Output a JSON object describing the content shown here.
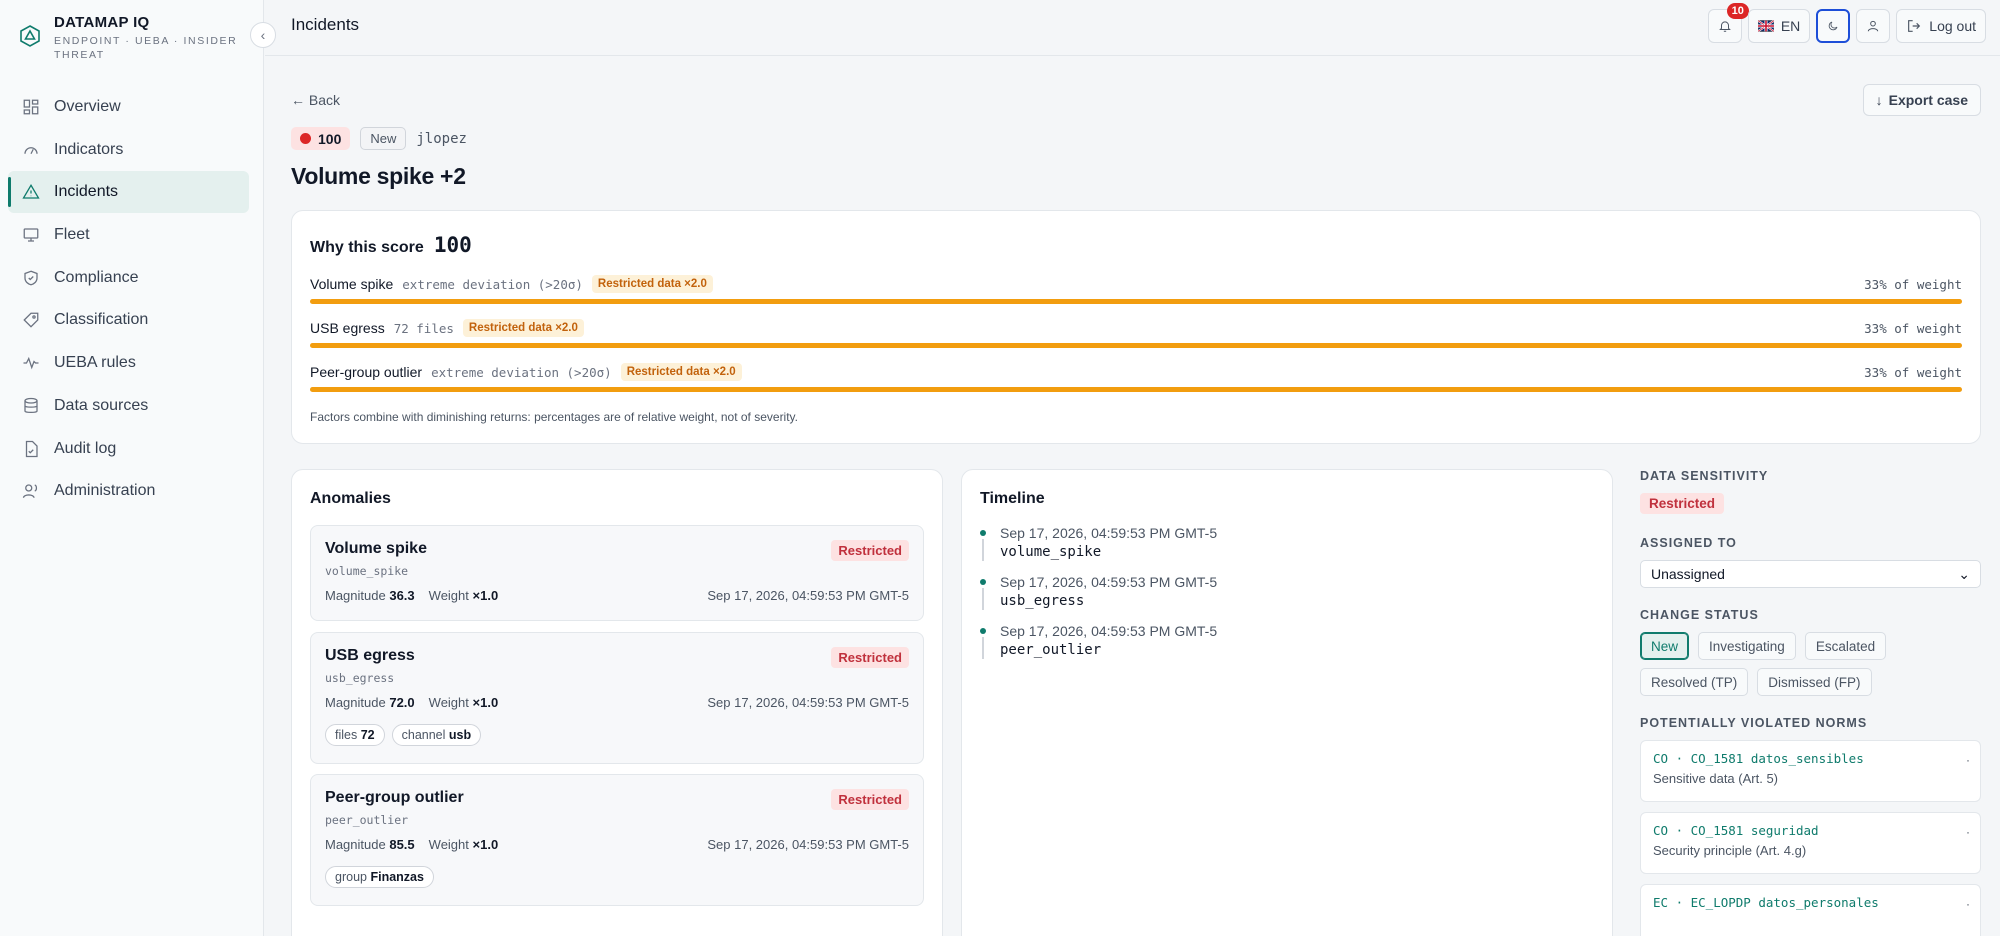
{
  "brand": {
    "name": "DATAMAP IQ",
    "subtitle": "ENDPOINT · UEBA · INSIDER THREAT"
  },
  "sidebar": {
    "items": [
      {
        "label": "Overview",
        "icon": "grid-icon"
      },
      {
        "label": "Indicators",
        "icon": "gauge-icon"
      },
      {
        "label": "Incidents",
        "icon": "alert-triangle-icon",
        "active": true
      },
      {
        "label": "Fleet",
        "icon": "monitor-icon"
      },
      {
        "label": "Compliance",
        "icon": "shield-check-icon"
      },
      {
        "label": "Classification",
        "icon": "tag-icon"
      },
      {
        "label": "UEBA rules",
        "icon": "activity-icon"
      },
      {
        "label": "Data sources",
        "icon": "database-icon"
      },
      {
        "label": "Audit log",
        "icon": "file-check-icon"
      },
      {
        "label": "Administration",
        "icon": "users-icon"
      }
    ]
  },
  "header": {
    "title": "Incidents",
    "notification_count": "10",
    "language": "EN",
    "logout_label": "Log out"
  },
  "incident": {
    "back_label": "Back",
    "export_label": "Export case",
    "score": "100",
    "status": "New",
    "user": "jlopez",
    "title": "Volume spike +2"
  },
  "score_card": {
    "title": "Why this score",
    "score": "100",
    "factors": [
      {
        "name": "Volume spike",
        "detail": "extreme deviation (>20σ)",
        "tag": "Restricted data ×2.0",
        "weight_label": "33% of weight",
        "fill": 1.0
      },
      {
        "name": "USB egress",
        "detail": "72 files",
        "tag": "Restricted data ×2.0",
        "weight_label": "33% of weight",
        "fill": 1.0
      },
      {
        "name": "Peer-group outlier",
        "detail": "extreme deviation (>20σ)",
        "tag": "Restricted data ×2.0",
        "weight_label": "33% of weight",
        "fill": 1.0
      }
    ],
    "note": "Factors combine with diminishing returns: percentages are of relative weight, not of severity."
  },
  "anomalies": {
    "title": "Anomalies",
    "magnitude_label": "Magnitude",
    "weight_label": "Weight",
    "items": [
      {
        "title": "Volume spike",
        "id": "volume_spike",
        "badge": "Restricted",
        "magnitude": "36.3",
        "weight": "×1.0",
        "date": "Sep 17, 2026, 04:59:53 PM GMT-5",
        "chips": []
      },
      {
        "title": "USB egress",
        "id": "usb_egress",
        "badge": "Restricted",
        "magnitude": "72.0",
        "weight": "×1.0",
        "date": "Sep 17, 2026, 04:59:53 PM GMT-5",
        "chips": [
          {
            "key": "files",
            "value": "72"
          },
          {
            "key": "channel",
            "value": "usb"
          }
        ]
      },
      {
        "title": "Peer-group outlier",
        "id": "peer_outlier",
        "badge": "Restricted",
        "magnitude": "85.5",
        "weight": "×1.0",
        "date": "Sep 17, 2026, 04:59:53 PM GMT-5",
        "chips": [
          {
            "key": "group",
            "value": "Finanzas"
          }
        ]
      }
    ]
  },
  "timeline": {
    "title": "Timeline",
    "events": [
      {
        "date": "Sep 17, 2026, 04:59:53 PM GMT-5",
        "event": "volume_spike"
      },
      {
        "date": "Sep 17, 2026, 04:59:53 PM GMT-5",
        "event": "usb_egress"
      },
      {
        "date": "Sep 17, 2026, 04:59:53 PM GMT-5",
        "event": "peer_outlier"
      }
    ]
  },
  "side_panel": {
    "sensitivity_label": "DATA SENSITIVITY",
    "sensitivity_value": "Restricted",
    "assigned_label": "ASSIGNED TO",
    "assigned_value": "Unassigned",
    "status_label": "CHANGE STATUS",
    "statuses": [
      "New",
      "Investigating",
      "Escalated",
      "Resolved (TP)",
      "Dismissed (FP)"
    ],
    "active_status": "New",
    "norms_label": "POTENTIALLY VIOLATED NORMS",
    "norms": [
      {
        "code": "CO · CO_1581 datos_sensibles",
        "desc": "Sensitive data (Art. 5)"
      },
      {
        "code": "CO · CO_1581 seguridad",
        "desc": "Security principle (Art. 4.g)"
      },
      {
        "code": "EC · EC_LOPDP datos_personales",
        "desc": ""
      }
    ]
  },
  "colors": {
    "accent": "#0f7b6c",
    "danger": "#dc2626",
    "bar": "#f29d0f",
    "tag": "#c2620c"
  }
}
